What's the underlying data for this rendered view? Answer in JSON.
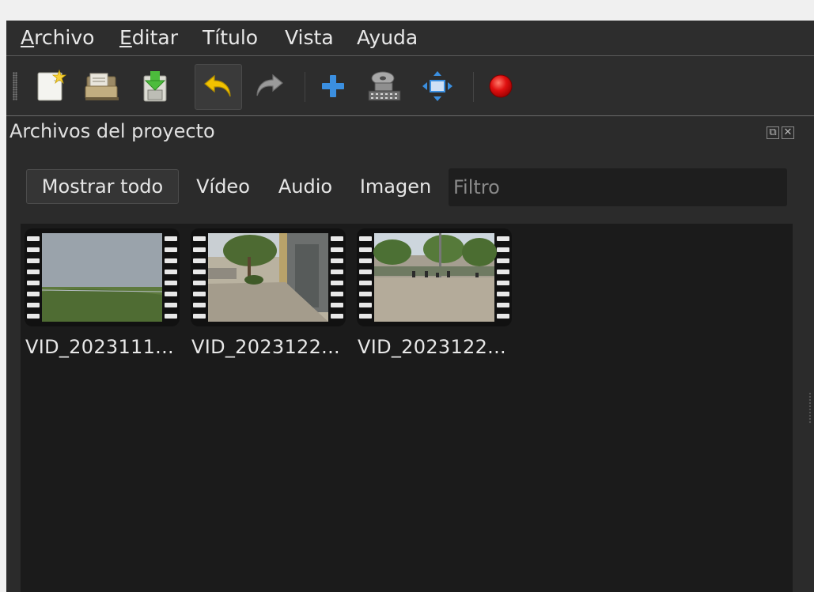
{
  "menu": {
    "items": [
      {
        "accel": "A",
        "rest": "rchivo"
      },
      {
        "accel": "E",
        "rest": "ditar"
      },
      {
        "accel": "",
        "rest": "Título"
      },
      {
        "accel": "",
        "rest": "Vista"
      },
      {
        "accel": "",
        "rest": "Ayuda"
      }
    ]
  },
  "toolbar": {
    "buttons": [
      {
        "icon": "new-project-icon"
      },
      {
        "icon": "open-project-icon"
      },
      {
        "icon": "save-project-icon"
      },
      {
        "icon": "undo-icon"
      },
      {
        "icon": "redo-icon"
      },
      {
        "icon": "import-files-icon"
      },
      {
        "icon": "profile-icon"
      },
      {
        "icon": "fullscreen-icon"
      },
      {
        "icon": "export-video-icon"
      }
    ]
  },
  "dock": {
    "title": "Archivos del proyecto"
  },
  "filters": {
    "show_all": "Mostrar todo",
    "video": "Vídeo",
    "audio": "Audio",
    "image": "Imagen",
    "placeholder": "Filtro"
  },
  "files": [
    {
      "label": "VID_2023111...",
      "scene": "fog-field"
    },
    {
      "label": "VID_2023122...",
      "scene": "street-sidewalk"
    },
    {
      "label": "VID_2023122...",
      "scene": "plaza"
    }
  ],
  "colors": {
    "undo": "#f2c200",
    "record": "#e01010",
    "accent_blue": "#3b8fe0"
  }
}
